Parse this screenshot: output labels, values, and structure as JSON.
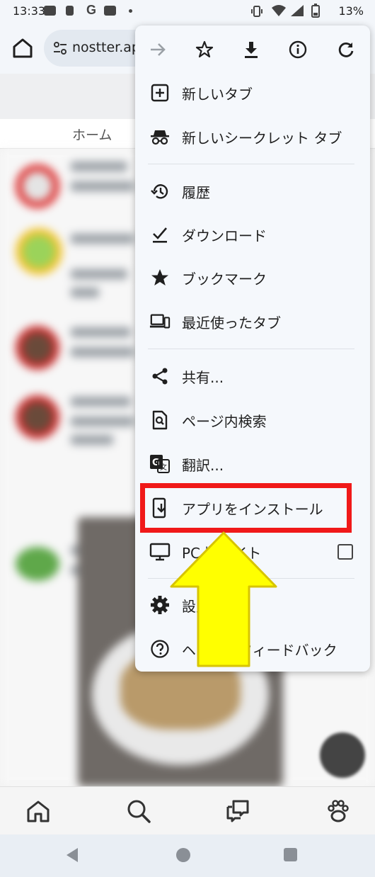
{
  "status_bar": {
    "time": "13:33",
    "google": "G",
    "battery": "13%"
  },
  "toolbar": {
    "url": "nostter.ap"
  },
  "page": {
    "tab_home": "ホーム"
  },
  "menu": {
    "items": [
      {
        "label": "新しいタブ"
      },
      {
        "label": "新しいシークレット タブ"
      },
      {
        "label": "履歴"
      },
      {
        "label": "ダウンロード"
      },
      {
        "label": "ブックマーク"
      },
      {
        "label": "最近使ったタブ"
      },
      {
        "label": "共有..."
      },
      {
        "label": "ページ内検索"
      },
      {
        "label": "翻訳..."
      },
      {
        "label": "アプリをインストール"
      },
      {
        "label": "PC 版サイト",
        "checked": false
      },
      {
        "label": "設定"
      },
      {
        "label": "ヘルプとフィードバック"
      }
    ]
  },
  "colors": {
    "highlight": "#f01919",
    "arrow": "#ffff00"
  }
}
